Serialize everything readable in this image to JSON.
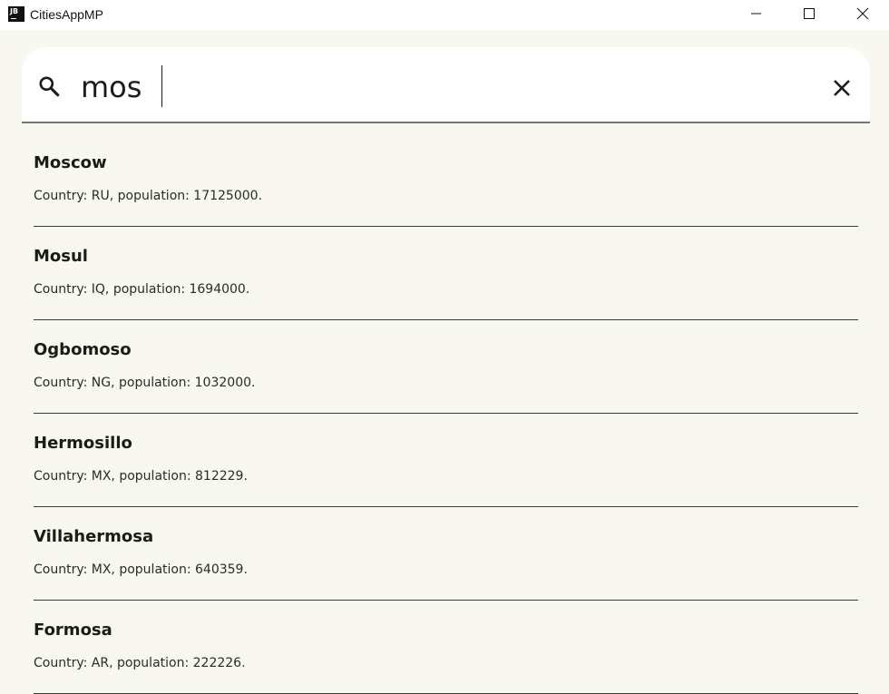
{
  "window": {
    "title": "CitiesAppMP",
    "icon_text": "JB"
  },
  "search": {
    "value": "mos",
    "icon": "search-icon",
    "clear_icon": "close-icon"
  },
  "results": [
    {
      "name": "Moscow",
      "info": "Country: RU, population: 17125000."
    },
    {
      "name": "Mosul",
      "info": "Country: IQ, population: 1694000."
    },
    {
      "name": "Ogbomoso",
      "info": "Country: NG, population: 1032000."
    },
    {
      "name": "Hermosillo",
      "info": "Country: MX, population: 812229."
    },
    {
      "name": "Villahermosa",
      "info": "Country: MX, population: 640359."
    },
    {
      "name": "Formosa",
      "info": "Country: AR, population: 222226."
    }
  ],
  "colors": {
    "background": "#f8f7f0",
    "search_underline": "#727768",
    "text": "#1b1c18"
  }
}
